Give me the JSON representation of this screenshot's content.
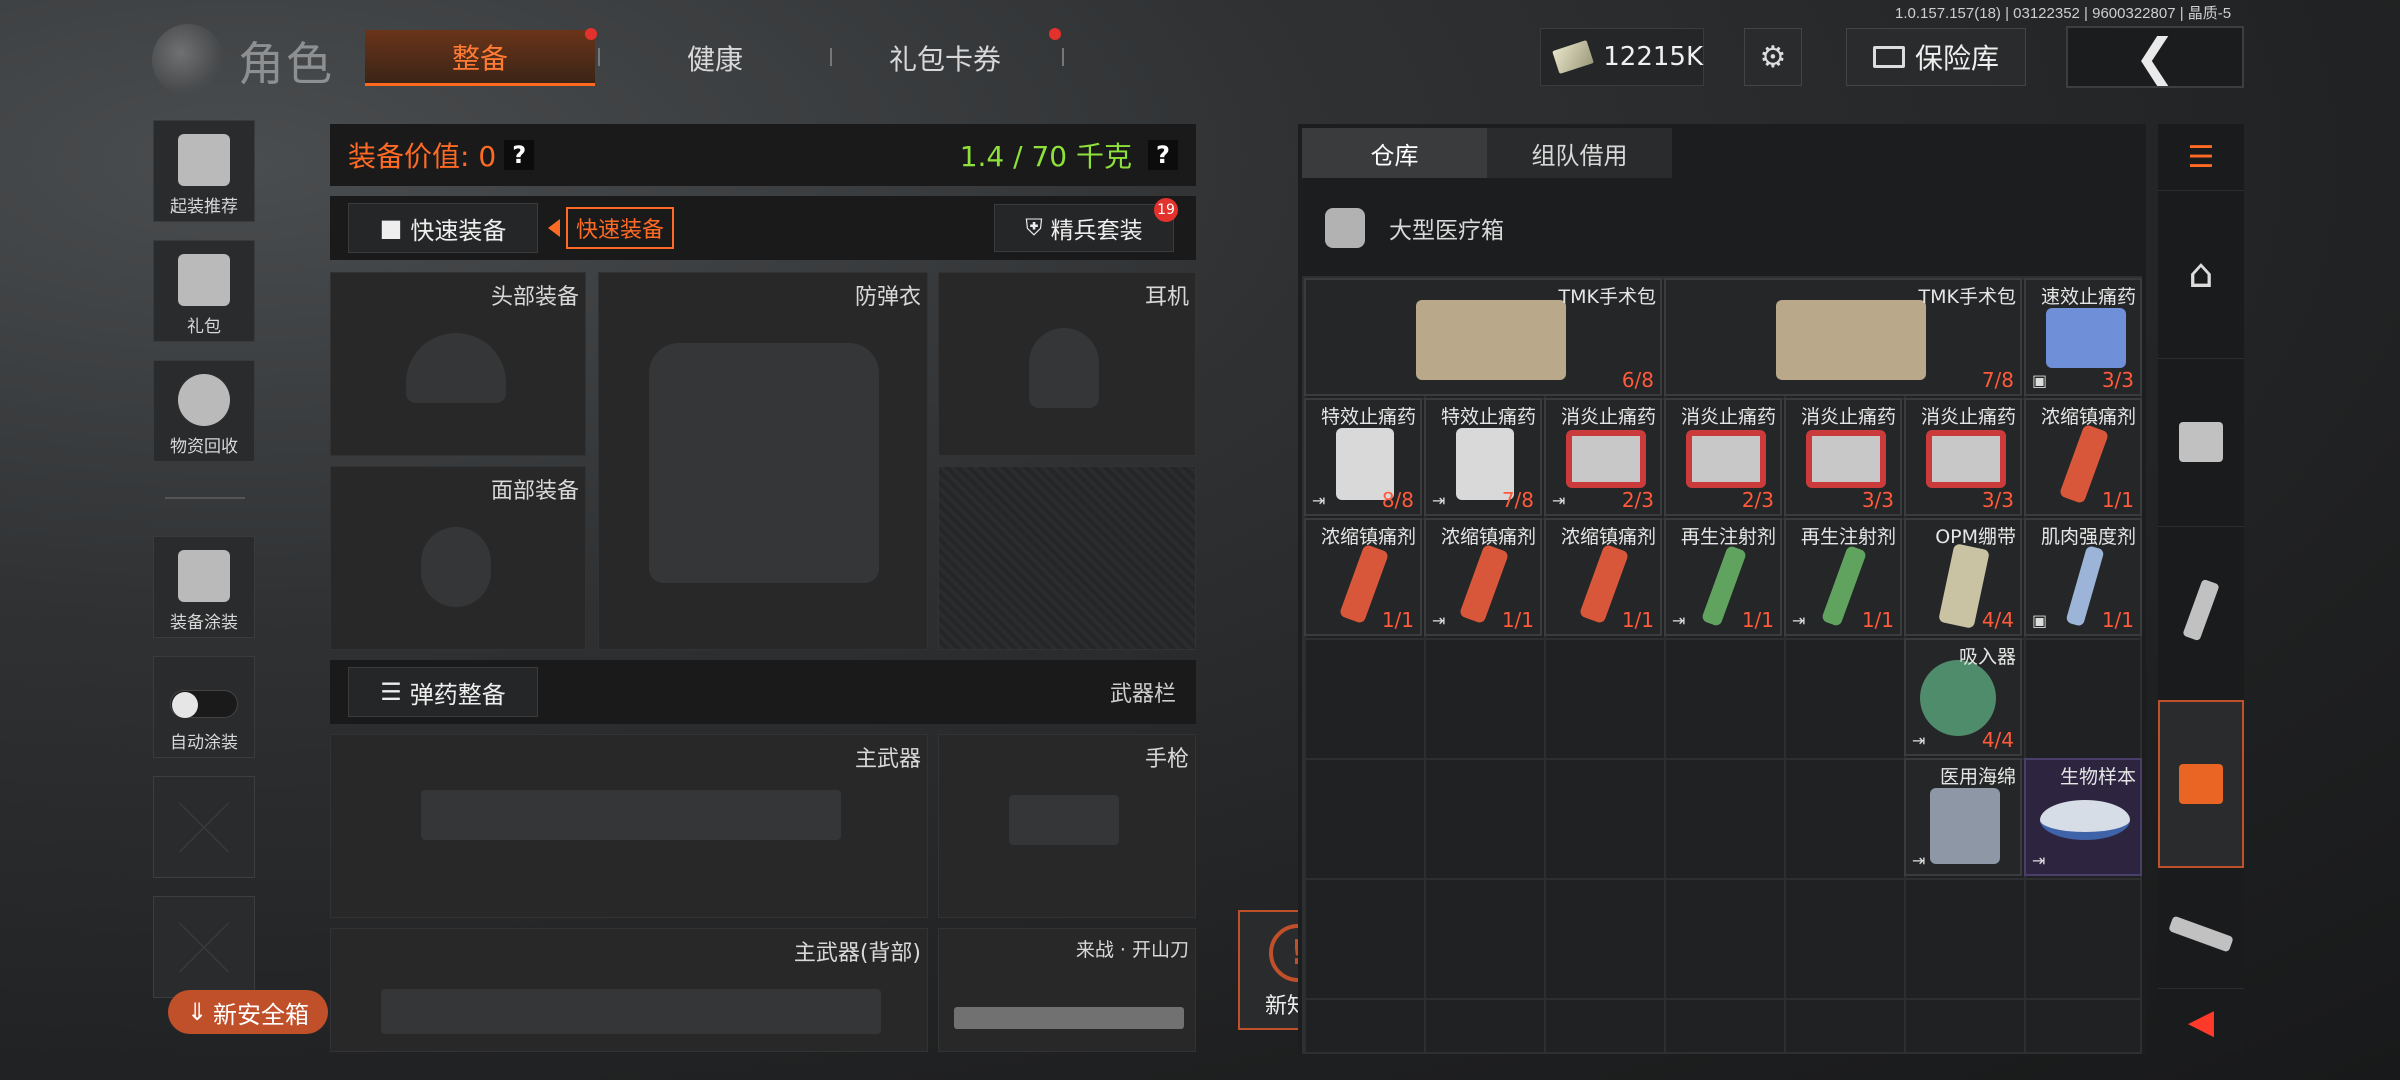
{
  "version": "1.0.157.157(18) | 03122352 | 9600322807 | 晶质-5",
  "header": {
    "title": "角色",
    "tabs": [
      {
        "label": "整备",
        "active": true,
        "dot": true
      },
      {
        "label": "健康",
        "active": false,
        "dot": false
      },
      {
        "label": "礼包卡券",
        "active": false,
        "dot": true
      }
    ],
    "currency": "12215K",
    "safe_label": "保险库",
    "back_icon": "chevron-left-icon"
  },
  "sidebar": {
    "items": [
      {
        "label": "起装推荐",
        "icon": "helmet-recommend-icon"
      },
      {
        "label": "礼包",
        "icon": "gift-icon"
      },
      {
        "label": "物资回收",
        "icon": "recycle-icon"
      },
      {
        "label": "装备涂装",
        "icon": "paint-helmet-icon"
      },
      {
        "label": "自动涂装",
        "icon": "toggle"
      }
    ],
    "new_safe_box": "新安全箱",
    "toggle_on": false
  },
  "equipment": {
    "value_label": "装备价值: 0",
    "weight_label": "1.4 / 70 千克",
    "help": "?",
    "quick_equip": "快速装备",
    "quick_equip_tip": "快速装备",
    "elite_suit": "精兵套装",
    "elite_badge": "19",
    "slots": {
      "head": "头部装备",
      "armor": "防弹衣",
      "ear": "耳机",
      "face": "面部装备",
      "primary": "主武器",
      "pistol": "手枪",
      "primary_back": "主武器(背部)",
      "melee": "来战 · 开山刀"
    },
    "ammo_button": "弹药整备",
    "weapon_bar": "武器栏"
  },
  "warehouse": {
    "tabs": [
      {
        "label": "仓库",
        "active": true
      },
      {
        "label": "组队借用",
        "active": false
      }
    ],
    "category": "大型医疗箱",
    "items": [
      {
        "name": "TMK手术包",
        "count": "6/8",
        "color": "#b9a98a"
      },
      {
        "name": "TMK手术包",
        "count": "7/8",
        "color": "#b9a98a"
      },
      {
        "name": "速效止痛药",
        "count": "3/3",
        "color": "#6f8fd8"
      },
      {
        "name": "特效止痛药",
        "count": "8/8",
        "color": "#d9d9d9"
      },
      {
        "name": "特效止痛药",
        "count": "7/8",
        "color": "#d9d9d9"
      },
      {
        "name": "消炎止痛药",
        "count": "2/3",
        "color": "#cc3b3b"
      },
      {
        "name": "消炎止痛药",
        "count": "2/3",
        "color": "#cc3b3b"
      },
      {
        "name": "消炎止痛药",
        "count": "3/3",
        "color": "#cc3b3b"
      },
      {
        "name": "消炎止痛药",
        "count": "3/3",
        "color": "#cc3b3b"
      },
      {
        "name": "浓缩镇痛剂",
        "count": "1/1",
        "color": "#d8563a"
      },
      {
        "name": "浓缩镇痛剂",
        "count": "1/1",
        "color": "#d8563a"
      },
      {
        "name": "浓缩镇痛剂",
        "count": "1/1",
        "color": "#d8563a"
      },
      {
        "name": "浓缩镇痛剂",
        "count": "1/1",
        "color": "#d8563a"
      },
      {
        "name": "再生注射剂",
        "count": "1/1",
        "color": "#5fa35f"
      },
      {
        "name": "再生注射剂",
        "count": "1/1",
        "color": "#5fa35f"
      },
      {
        "name": "OPM绷带",
        "count": "4/4",
        "color": "#c9c3a4"
      },
      {
        "name": "肌肉强度剂",
        "count": "1/1",
        "color": "#9cb4d8"
      },
      {
        "name": "吸入器",
        "count": "4/4",
        "color": "#4f8c6c"
      },
      {
        "name": "医用海绵",
        "count": "",
        "color": "#8e97a6"
      },
      {
        "name": "生物样本",
        "count": "",
        "color": "#d7dde6"
      }
    ]
  },
  "new_knowledge": "新知识",
  "rail": [
    "menu-icon",
    "home-icon",
    "safe-box-icon",
    "magazine-icon",
    "medkit-icon",
    "rifle-icon",
    "collapse-icon"
  ],
  "colors": {
    "accent": "#ff6a24",
    "weight_green": "#8ee13a",
    "red": "#e3312c"
  }
}
